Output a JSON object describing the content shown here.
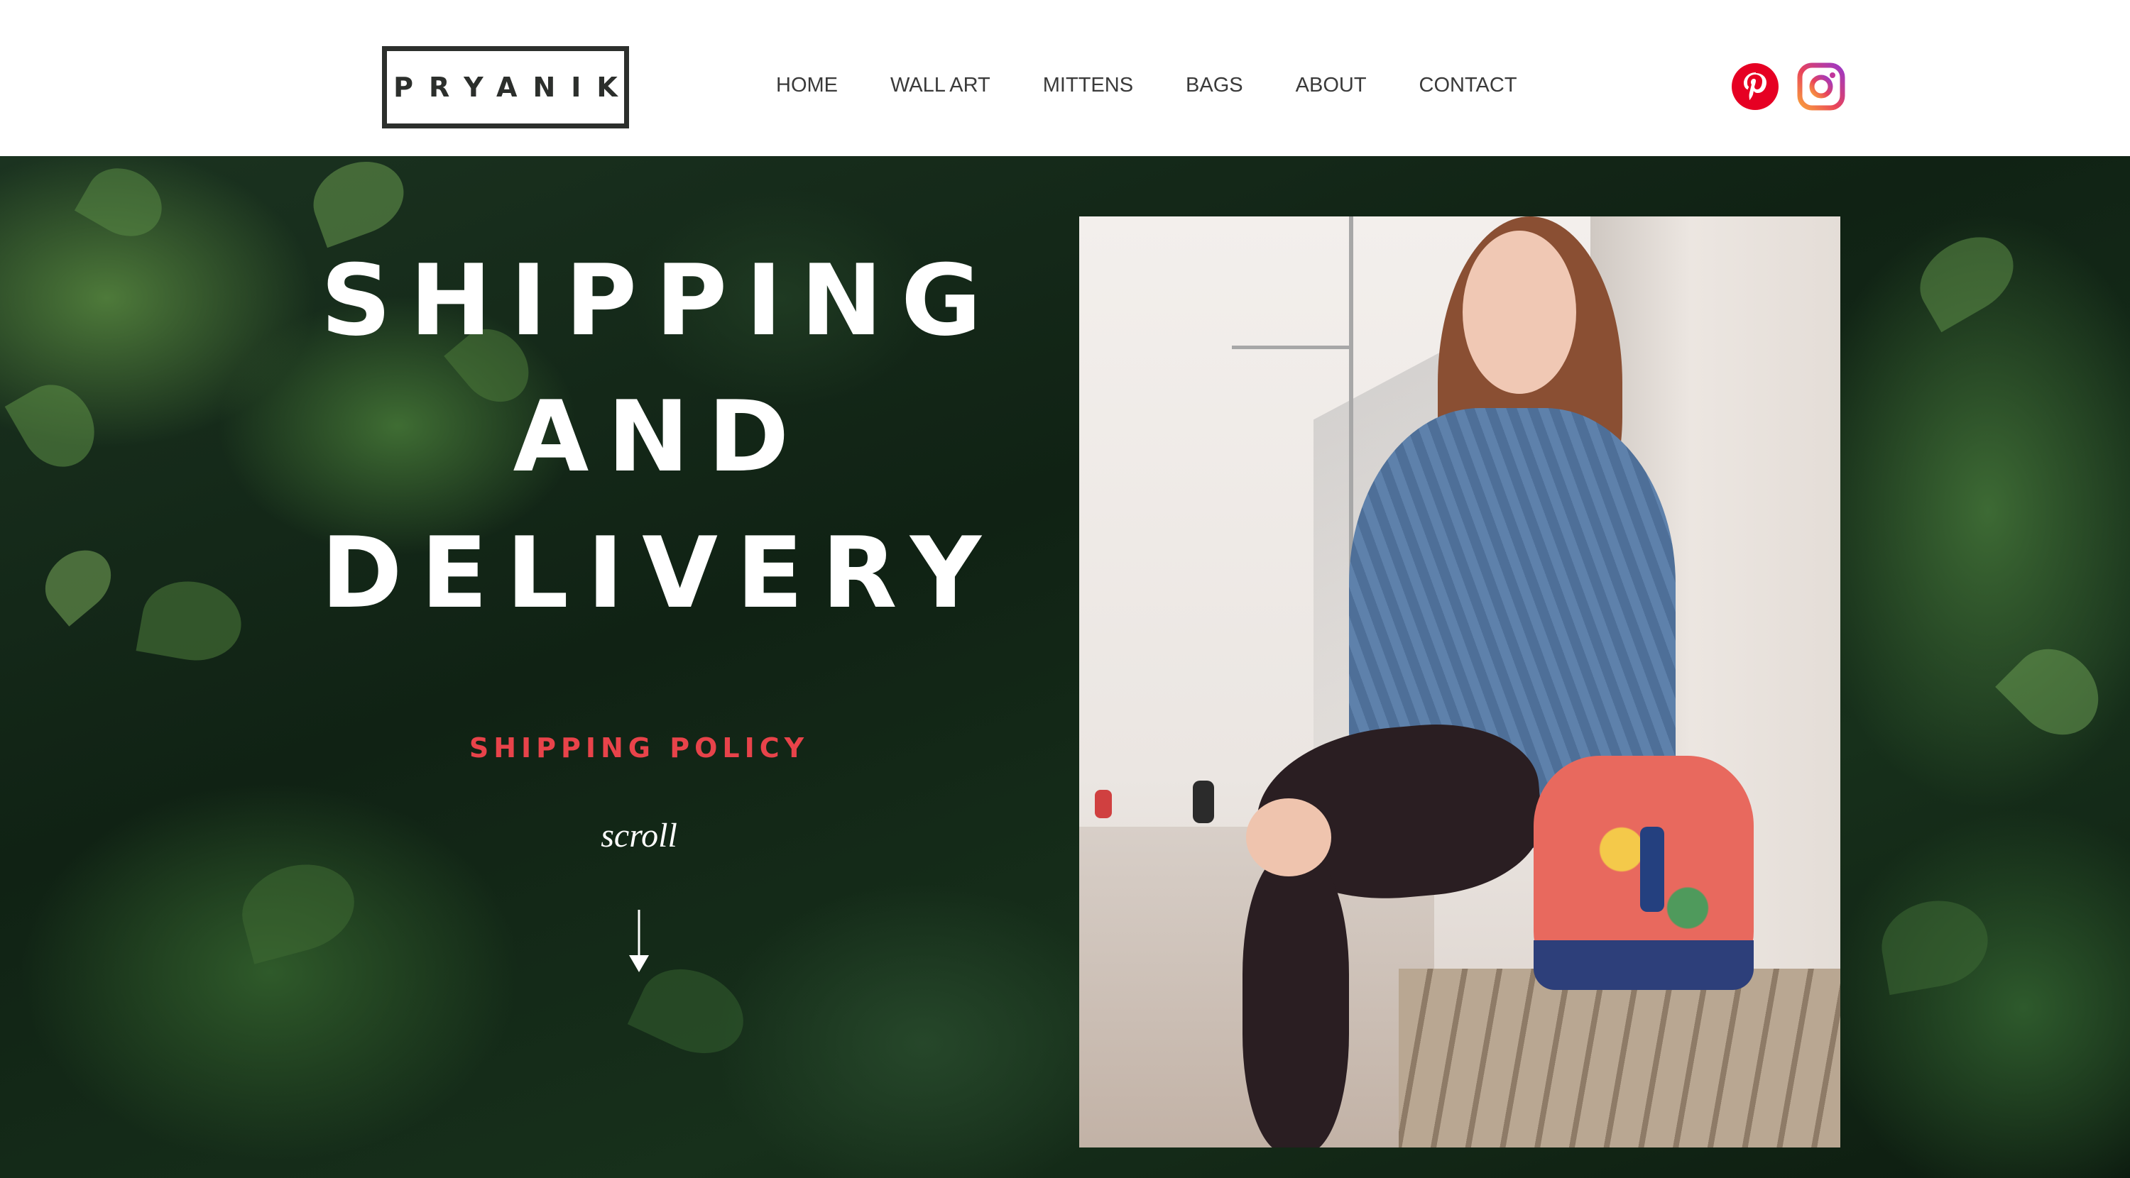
{
  "header": {
    "logo": "PRYANIK",
    "nav": [
      "HOME",
      "WALL ART",
      "MITTENS",
      "BAGS",
      "ABOUT",
      "CONTACT"
    ],
    "social": [
      {
        "name": "pinterest-icon",
        "color": "#e60023"
      },
      {
        "name": "instagram-icon",
        "color": "#d6249f"
      }
    ]
  },
  "hero": {
    "title_lines": [
      "SHIPPING",
      "AND",
      "DELIVERY"
    ],
    "policy_link": "SHIPPING POLICY",
    "scroll_label": "scroll",
    "accent_color": "#e8434a"
  }
}
